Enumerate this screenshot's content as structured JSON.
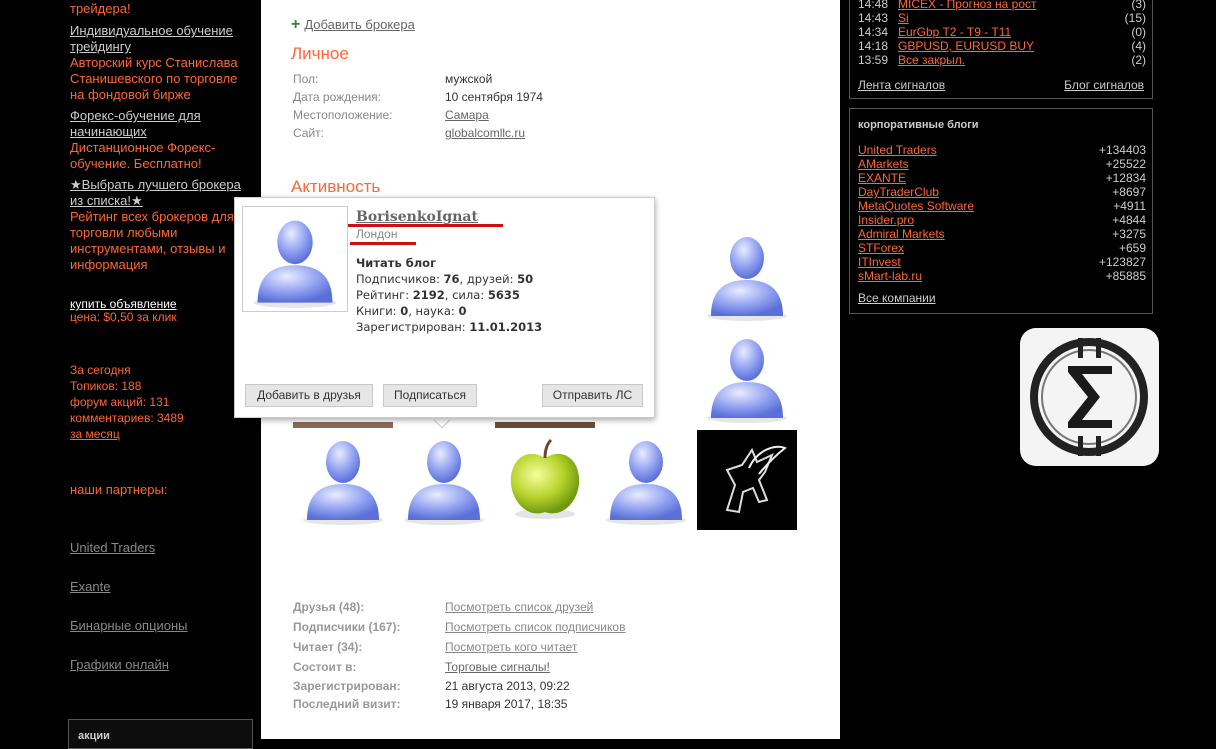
{
  "left": {
    "promo1_tail": "трейдера!",
    "promo2_title": "Индивидуальное обучение трейдингу",
    "promo2_text": "Авторский курс Станислава Станишевского по торговле на фондовой бирже",
    "promo3_title": "Форекс-обучение для начинающих",
    "promo3_text": "Дистанционное Форекс-обучение. Бесплатно!",
    "promo4_title": "★Выбрать лучшего брокера из списка!★",
    "promo4_text": "Рейтинг всех брокеров для торговли любыми инструментами, отзывы и информация",
    "buy_ad": "купить объявление",
    "ad_price": "цена: $0,50 за клик",
    "today": "За сегодня",
    "topics": "Топиков: 188",
    "forum": "форум акций: 131",
    "comments": "комментариев: 3489",
    "month": "за месяц",
    "partners_title": "наши партнеры:",
    "partners": [
      "United Traders",
      "Exante",
      "Бинарные опционы",
      "Графики онлайн"
    ],
    "stock_box_title": "акции"
  },
  "main": {
    "add_broker": "Добавить брокера",
    "personal_title": "Личное",
    "personal": [
      {
        "label": "Пол:",
        "value": "мужской"
      },
      {
        "label": "Дата рождения:",
        "value": "10 сентября 1974"
      },
      {
        "label": "Местоположение:",
        "value": "Самара"
      },
      {
        "label": "Сайт:",
        "value": "globalcomllc.ru"
      }
    ],
    "activity_title": "Активность",
    "stats": [
      {
        "label": "Друзья (48):",
        "value": "Посмотреть список друзей"
      },
      {
        "label": "Подписчики (167):",
        "value": "Посмотреть список подписчиков"
      },
      {
        "label": "Читает (34):",
        "value": "Посмотреть кого читает"
      },
      {
        "label": "Состоит в:",
        "value": "Торговые сигналы!"
      },
      {
        "label": "Зарегистрирован:",
        "value": "21 августа 2013, 09:22"
      },
      {
        "label": "Последний визит:",
        "value": "19 января 2017, 18:35"
      }
    ]
  },
  "popup": {
    "username": "BorisenkoIgnat",
    "city": "Лондон",
    "read_blog": "Читать блог",
    "subs_label": "Подписчиков:",
    "subs": "76",
    "friends_label": "друзей:",
    "friends": "50",
    "rating_label": "Рейтинг:",
    "rating": "2192",
    "power_label": "сила:",
    "power": "5635",
    "books_label": "Книги:",
    "books": "0",
    "science_label": "наука:",
    "science": "0",
    "registered_label": "Зарегистрирован:",
    "registered": "11.01.2013",
    "btn_add_friend": "Добавить в друзья",
    "btn_subscribe": "Подписаться",
    "btn_message": "Отправить ЛС"
  },
  "signals": {
    "rows": [
      {
        "time": "14:48",
        "name": "MICEX - Прогноз на рост",
        "count": "(3)"
      },
      {
        "time": "14:43",
        "name": "Si",
        "count": "(15)"
      },
      {
        "time": "14:34",
        "name": "EurGbp T2 - T9 - T11",
        "count": "(0)"
      },
      {
        "time": "14:18",
        "name": "GBPUSD, EURUSD BUY",
        "count": "(4)"
      },
      {
        "time": "13:59",
        "name": "Все закрыл.",
        "count": "(2)"
      }
    ],
    "feed_link": "Лента сигналов",
    "blog_link": "Блог сигналов"
  },
  "corp": {
    "title": "корпоративные блоги",
    "rows": [
      {
        "name": "United Traders",
        "value": "+134403"
      },
      {
        "name": "AMarkets",
        "value": "+25522"
      },
      {
        "name": "EXANTE",
        "value": "+12834"
      },
      {
        "name": "DayTraderClub",
        "value": "+8697"
      },
      {
        "name": "MetaQuotes Software",
        "value": "+4911"
      },
      {
        "name": "Insider.pro",
        "value": "+4844"
      },
      {
        "name": "Admiral Markets",
        "value": "+3275"
      },
      {
        "name": "STForex",
        "value": "+659"
      },
      {
        "name": "ITInvest",
        "value": "+123827"
      },
      {
        "name": "sMart-lab.ru",
        "value": "+85885"
      }
    ],
    "all_link": "Все компании"
  }
}
